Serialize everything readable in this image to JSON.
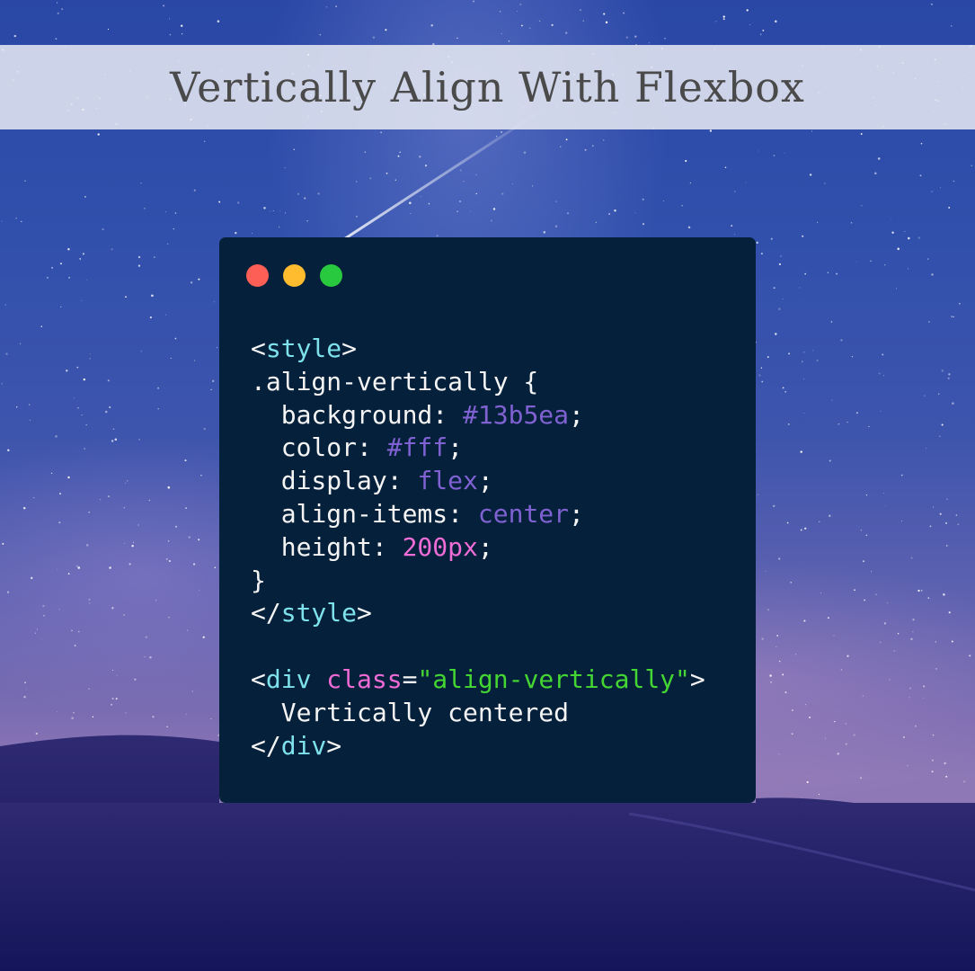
{
  "title": "Vertically Align With Flexbox",
  "window_controls": [
    "close-dot",
    "minimize-dot",
    "maximize-dot"
  ],
  "colors": {
    "band": "#e8eaf2",
    "window": "#05203a",
    "tag": "#7ee2ec",
    "value": "#7f61d2",
    "number": "#f06cd6",
    "string": "#44d632",
    "dot_red": "#fd5f56",
    "dot_yellow": "#febc2e",
    "dot_green": "#28c83f"
  },
  "code": {
    "l1": {
      "open": "<",
      "tag": "style",
      "close": ">"
    },
    "l2": {
      "text": ".align-vertically {"
    },
    "l3": {
      "prop": "  background: ",
      "value": "#13b5ea",
      "end": ";"
    },
    "l4": {
      "prop": "  color: ",
      "value": "#fff",
      "end": ";"
    },
    "l5": {
      "prop": "  display: ",
      "value": "flex",
      "end": ";"
    },
    "l6": {
      "prop": "  align-items: ",
      "value": "center",
      "end": ";"
    },
    "l7": {
      "prop": "  height: ",
      "value": "200px",
      "end": ";"
    },
    "l8": {
      "text": "}"
    },
    "l9": {
      "open": "</",
      "tag": "style",
      "close": ">"
    },
    "l11": {
      "open": "<",
      "tag": "div",
      "space": " ",
      "attr": "class",
      "eq": "=",
      "str": "\"align-vertically\"",
      "close": ">"
    },
    "l12": {
      "text": "  Vertically centered"
    },
    "l13": {
      "open": "</",
      "tag": "div",
      "close": ">"
    }
  }
}
